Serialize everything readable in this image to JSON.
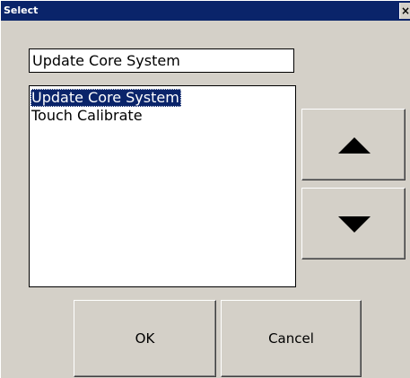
{
  "window": {
    "title": "Select",
    "close_glyph": "×"
  },
  "selection_field": {
    "value": "Update Core System"
  },
  "list": {
    "items": [
      {
        "label": "Update Core System",
        "selected": true
      },
      {
        "label": "Touch Calibrate",
        "selected": false
      }
    ]
  },
  "scroll_buttons": {
    "up_icon": "triangle-up-icon",
    "down_icon": "triangle-down-icon"
  },
  "dialog_buttons": {
    "ok_label": "OK",
    "cancel_label": "Cancel"
  },
  "colors": {
    "title_bar": "#0a246a",
    "selection": "#0a246a",
    "face": "#d4d0c8"
  }
}
